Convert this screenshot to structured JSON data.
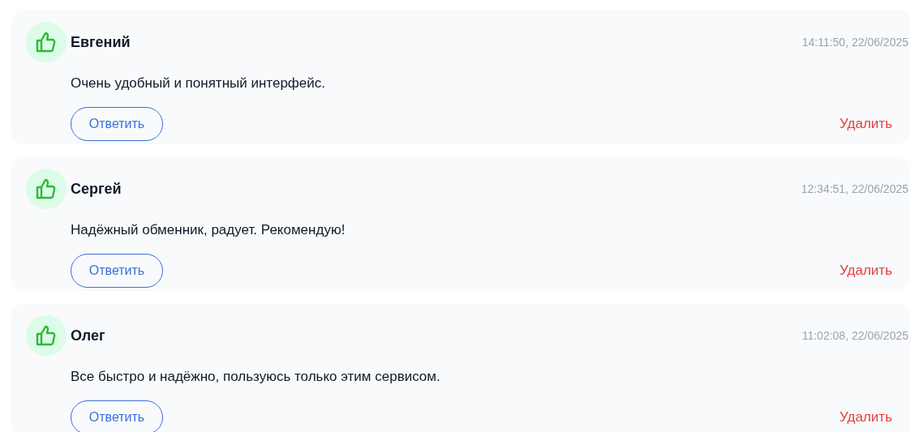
{
  "reviews": [
    {
      "name": "Евгений",
      "time": "14:11:50, 22/06/2025",
      "text": "Очень удобный и понятный интерфейс.",
      "reply": "Ответить",
      "delete": "Удалить"
    },
    {
      "name": "Сергей",
      "time": "12:34:51, 22/06/2025",
      "text": "Надёжный обменник, радует. Рекомендую!",
      "reply": "Ответить",
      "delete": "Удалить"
    },
    {
      "name": "Олег",
      "time": "11:02:08, 22/06/2025",
      "text": "Все быстро и надёжно, пользуюсь только этим сервисом.",
      "reply": "Ответить",
      "delete": "Удалить"
    }
  ]
}
